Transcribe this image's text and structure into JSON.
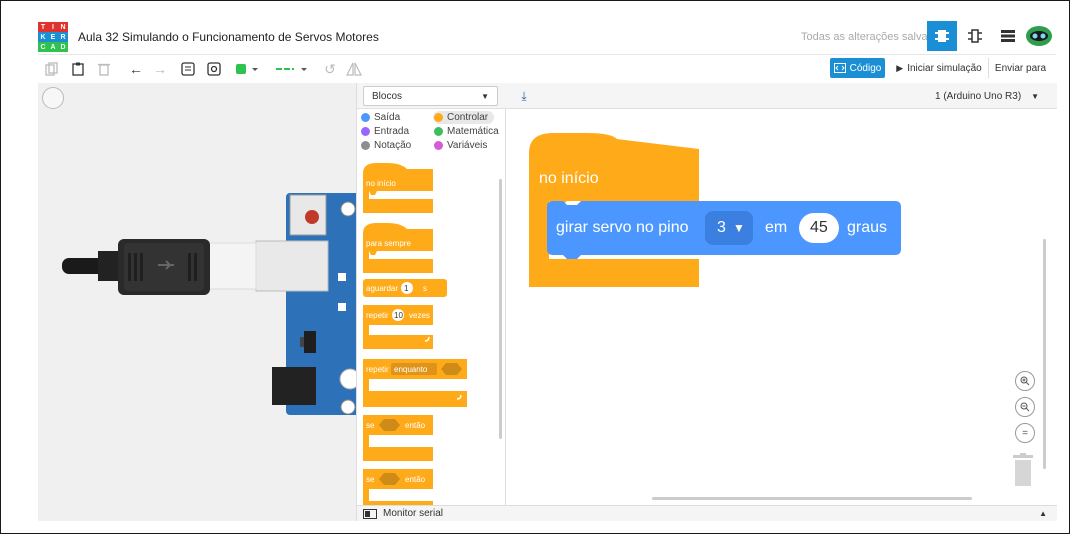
{
  "app": {
    "logo_letters": [
      "T",
      "I",
      "N",
      "K",
      "E",
      "R",
      "C",
      "A",
      "D"
    ],
    "title": "Aula 32 Simulando o Funcionamento de Servos Motores",
    "save_status": "Todas as alterações salvas"
  },
  "toolbar": {
    "code_label": "Código",
    "simulate_label": "Iniciar simulação",
    "send_label": "Enviar para"
  },
  "code_panel": {
    "mode_select": "Blocos",
    "device_select": "1 (Arduino Uno R3)",
    "categories": [
      {
        "label": "Saída",
        "color": "#4c97ff"
      },
      {
        "label": "Controlar",
        "color": "#ffab19"
      },
      {
        "label": "Entrada",
        "color": "#9966ff"
      },
      {
        "label": "Matemática",
        "color": "#3dbd5e"
      },
      {
        "label": "Notação",
        "color": "#8e8e8e"
      },
      {
        "label": "Variáveis",
        "color": "#d65cd6"
      }
    ],
    "palette_blocks": {
      "on_start": "no início",
      "forever": "para sempre",
      "wait_prefix": "aguardar",
      "wait_value": "1",
      "wait_unit": "s",
      "repeat_prefix": "repetir",
      "repeat_value": "10",
      "repeat_suffix": "vezes",
      "repeat_while": "repetir",
      "while_option": "enquanto",
      "if1_prefix": "se",
      "if1_suffix": "então",
      "if2_prefix": "se",
      "if2_suffix": "então"
    },
    "workspace": {
      "hat_label": "no início",
      "servo_prefix": "girar servo no pino",
      "pin_value": "3",
      "middle": "em",
      "angle_value": "45",
      "suffix": "graus"
    },
    "monitor_label": "Monitor serial"
  },
  "colors": {
    "control": "#ffab19",
    "output": "#4c97ff",
    "accent": "#1b8fd6",
    "board": "#2d72b8"
  }
}
